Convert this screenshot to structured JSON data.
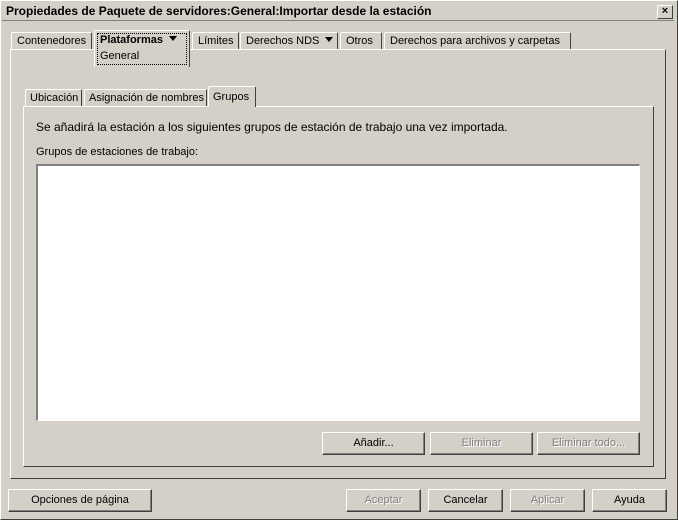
{
  "window": {
    "title": "Propiedades de Paquete de servidores:General:Importar desde la estación",
    "close_label": "×"
  },
  "tabs": [
    {
      "label": "Contenedores"
    },
    {
      "label": "Plataformas",
      "sub_label": "General"
    },
    {
      "label": "Límites"
    },
    {
      "label": "Derechos NDS"
    },
    {
      "label": "Otros"
    },
    {
      "label": "Derechos para archivos y carpetas"
    }
  ],
  "subtabs": [
    {
      "label": "Ubicación"
    },
    {
      "label": "Asignación de nombres"
    },
    {
      "label": "Grupos"
    }
  ],
  "panel": {
    "info_text": "Se añadirá la estación a los siguientes grupos de estación de trabajo una vez importada.",
    "list_label": "Grupos de estaciones de trabajo:",
    "list_items": []
  },
  "panel_buttons": {
    "add": "Añadir...",
    "remove": "Eliminar",
    "remove_all": "Eliminar todo..."
  },
  "footer": {
    "page_options": "Opciones de página",
    "accept": "Aceptar",
    "cancel": "Cancelar",
    "apply": "Aplicar",
    "help": "Ayuda"
  }
}
